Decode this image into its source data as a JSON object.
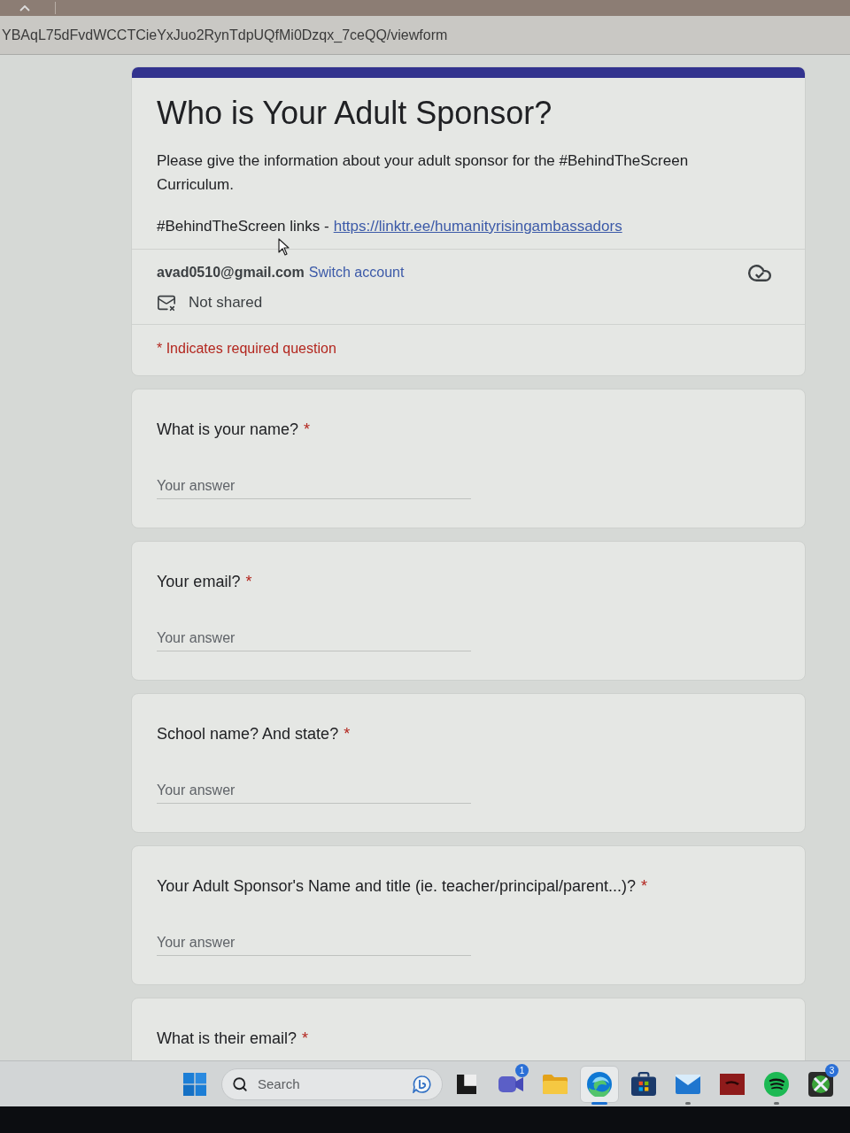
{
  "browser": {
    "url": "YBAqL75dFvdWCCTCieYxJuo2RynTdpUQfMi0Dzqx_7ceQQ/viewform"
  },
  "form": {
    "title": "Who is Your Adult Sponsor?",
    "description": "Please give the information about your adult sponsor for the #BehindTheScreen Curriculum.",
    "links_label": "#BehindTheScreen links -",
    "links_url": "https://linktr.ee/humanityrisingambassadors",
    "account_email": "avad0510@gmail.com",
    "switch_account": "Switch account",
    "sharing": "Not shared",
    "required_note": "* Indicates required question"
  },
  "questions": [
    {
      "label": "What is your name?",
      "required_mark": "*",
      "placeholder": "Your answer"
    },
    {
      "label": "Your email?",
      "required_mark": "*",
      "placeholder": "Your answer"
    },
    {
      "label": "School name? And state?",
      "required_mark": "*",
      "placeholder": "Your answer"
    },
    {
      "label": "Your Adult Sponsor's Name and title (ie. teacher/principal/parent...)?",
      "required_mark": "*",
      "placeholder": "Your answer"
    },
    {
      "label": "What is their email?",
      "required_mark": "*"
    }
  ],
  "taskbar": {
    "search_placeholder": "Search",
    "apps": [
      {
        "kind": "task-view",
        "running": false,
        "selected": false
      },
      {
        "kind": "chat",
        "badge": "1",
        "running": false,
        "selected": false
      },
      {
        "kind": "folder",
        "running": false,
        "selected": false
      },
      {
        "kind": "edge",
        "running": true,
        "selected": true
      },
      {
        "kind": "store",
        "running": false,
        "selected": false
      },
      {
        "kind": "mail",
        "running": true,
        "selected": false
      },
      {
        "kind": "tile",
        "running": false,
        "selected": false
      },
      {
        "kind": "music",
        "running": true,
        "selected": false
      },
      {
        "kind": "xbox",
        "badge": "3",
        "running": false,
        "selected": false
      }
    ]
  }
}
